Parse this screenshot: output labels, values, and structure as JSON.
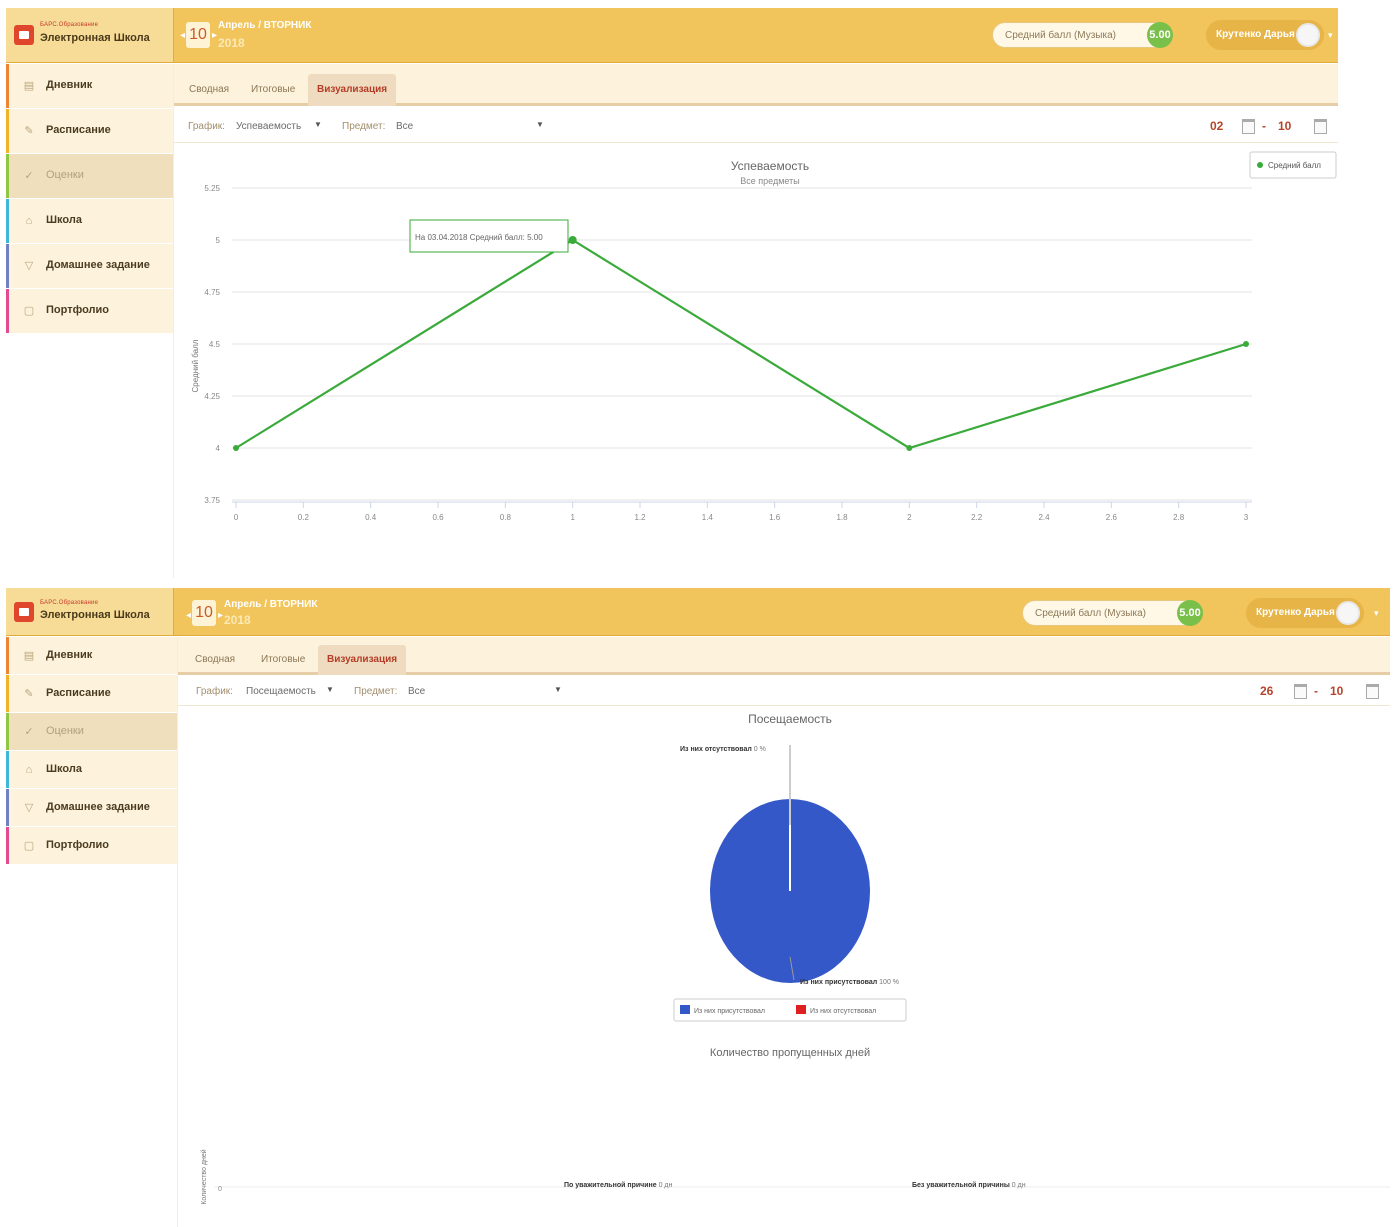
{
  "app": {
    "logo_small": "БАРС.Образование",
    "logo_title": "Электронная Школа"
  },
  "header": {
    "day": "10",
    "month_weekday": "Апрель / ВТОРНИК",
    "year": "2018",
    "avg_label": "Средний балл (Музыка)",
    "avg_value": "5.00",
    "user_name": "Крутенко Дарья"
  },
  "sidebar": {
    "items": [
      {
        "label": "Дневник",
        "icon": "book-icon",
        "color": "#ee8436"
      },
      {
        "label": "Расписание",
        "icon": "pin-icon",
        "color": "#f0b32b"
      },
      {
        "label": "Оценки",
        "icon": "check-icon",
        "color": "#8fc644"
      },
      {
        "label": "Школа",
        "icon": "school-icon",
        "color": "#3fb7d8"
      },
      {
        "label": "Домашнее задание",
        "icon": "homework-icon",
        "color": "#6f80c3"
      },
      {
        "label": "Портфолио",
        "icon": "portfolio-icon",
        "color": "#e24c8e"
      }
    ]
  },
  "tabs": {
    "summary": "Сводная",
    "final": "Итоговые",
    "visual": "Визуализация"
  },
  "filters": {
    "chart_label": "График:",
    "subject_label": "Предмет:",
    "subject_value": "Все",
    "to": "10",
    "range_sep": "-"
  },
  "panel1": {
    "chart_value": "Успеваемость",
    "from": "02",
    "legend": "Средний балл",
    "tooltip": "На 03.04.2018 Средний балл: 5.00",
    "y_axis_label": "Средний балл"
  },
  "panel2": {
    "chart_value": "Посещаемость",
    "from": "26",
    "absent_title": "Количество пропущенных дней",
    "absent_y_label": "Количество дней",
    "absent_cats": [
      "По уважительной причине",
      "Без уважительной причины"
    ],
    "absent_vals": [
      "0 дн",
      "0 дн"
    ],
    "absent_tick": "0"
  },
  "chart_data": [
    {
      "type": "line",
      "title": "Успеваемость",
      "subtitle": "Все предметы",
      "ylabel": "Средний балл",
      "x": [
        0,
        1,
        2,
        3
      ],
      "series": [
        {
          "name": "Средний балл",
          "values": [
            4.0,
            5.0,
            4.0,
            4.5
          ],
          "color": "#3aaa3a"
        }
      ],
      "ylim": [
        3.75,
        5.25
      ],
      "yticks": [
        3.75,
        4,
        4.25,
        4.5,
        4.75,
        5,
        5.25
      ],
      "ytick_labels": [
        "3.75",
        "4",
        "4.25",
        "4.5",
        "4.75",
        "5",
        "5.25"
      ],
      "xlim": [
        0,
        3
      ],
      "xticks": [
        0,
        0.2,
        0.4,
        0.6,
        0.8,
        1,
        1.2,
        1.4,
        1.6,
        1.8,
        2,
        2.2,
        2.4,
        2.6,
        2.8,
        3
      ],
      "xtick_labels": [
        "0",
        "0.2",
        "0.4",
        "0.6",
        "0.8",
        "1",
        "1.2",
        "1.4",
        "1.6",
        "1.8",
        "2",
        "2.2",
        "2.4",
        "2.6",
        "2.8",
        "3"
      ],
      "grid": true,
      "legend": "top-right"
    },
    {
      "type": "pie",
      "title": "Посещаемость",
      "slices": [
        {
          "name": "Из них присутствовал",
          "value": 100,
          "value_label": "100 %",
          "color": "#3558c8"
        },
        {
          "name": "Из них отсутствовал",
          "value": 0,
          "value_label": "0 %",
          "color": "#e02020"
        }
      ],
      "legend": "bottom"
    }
  ]
}
